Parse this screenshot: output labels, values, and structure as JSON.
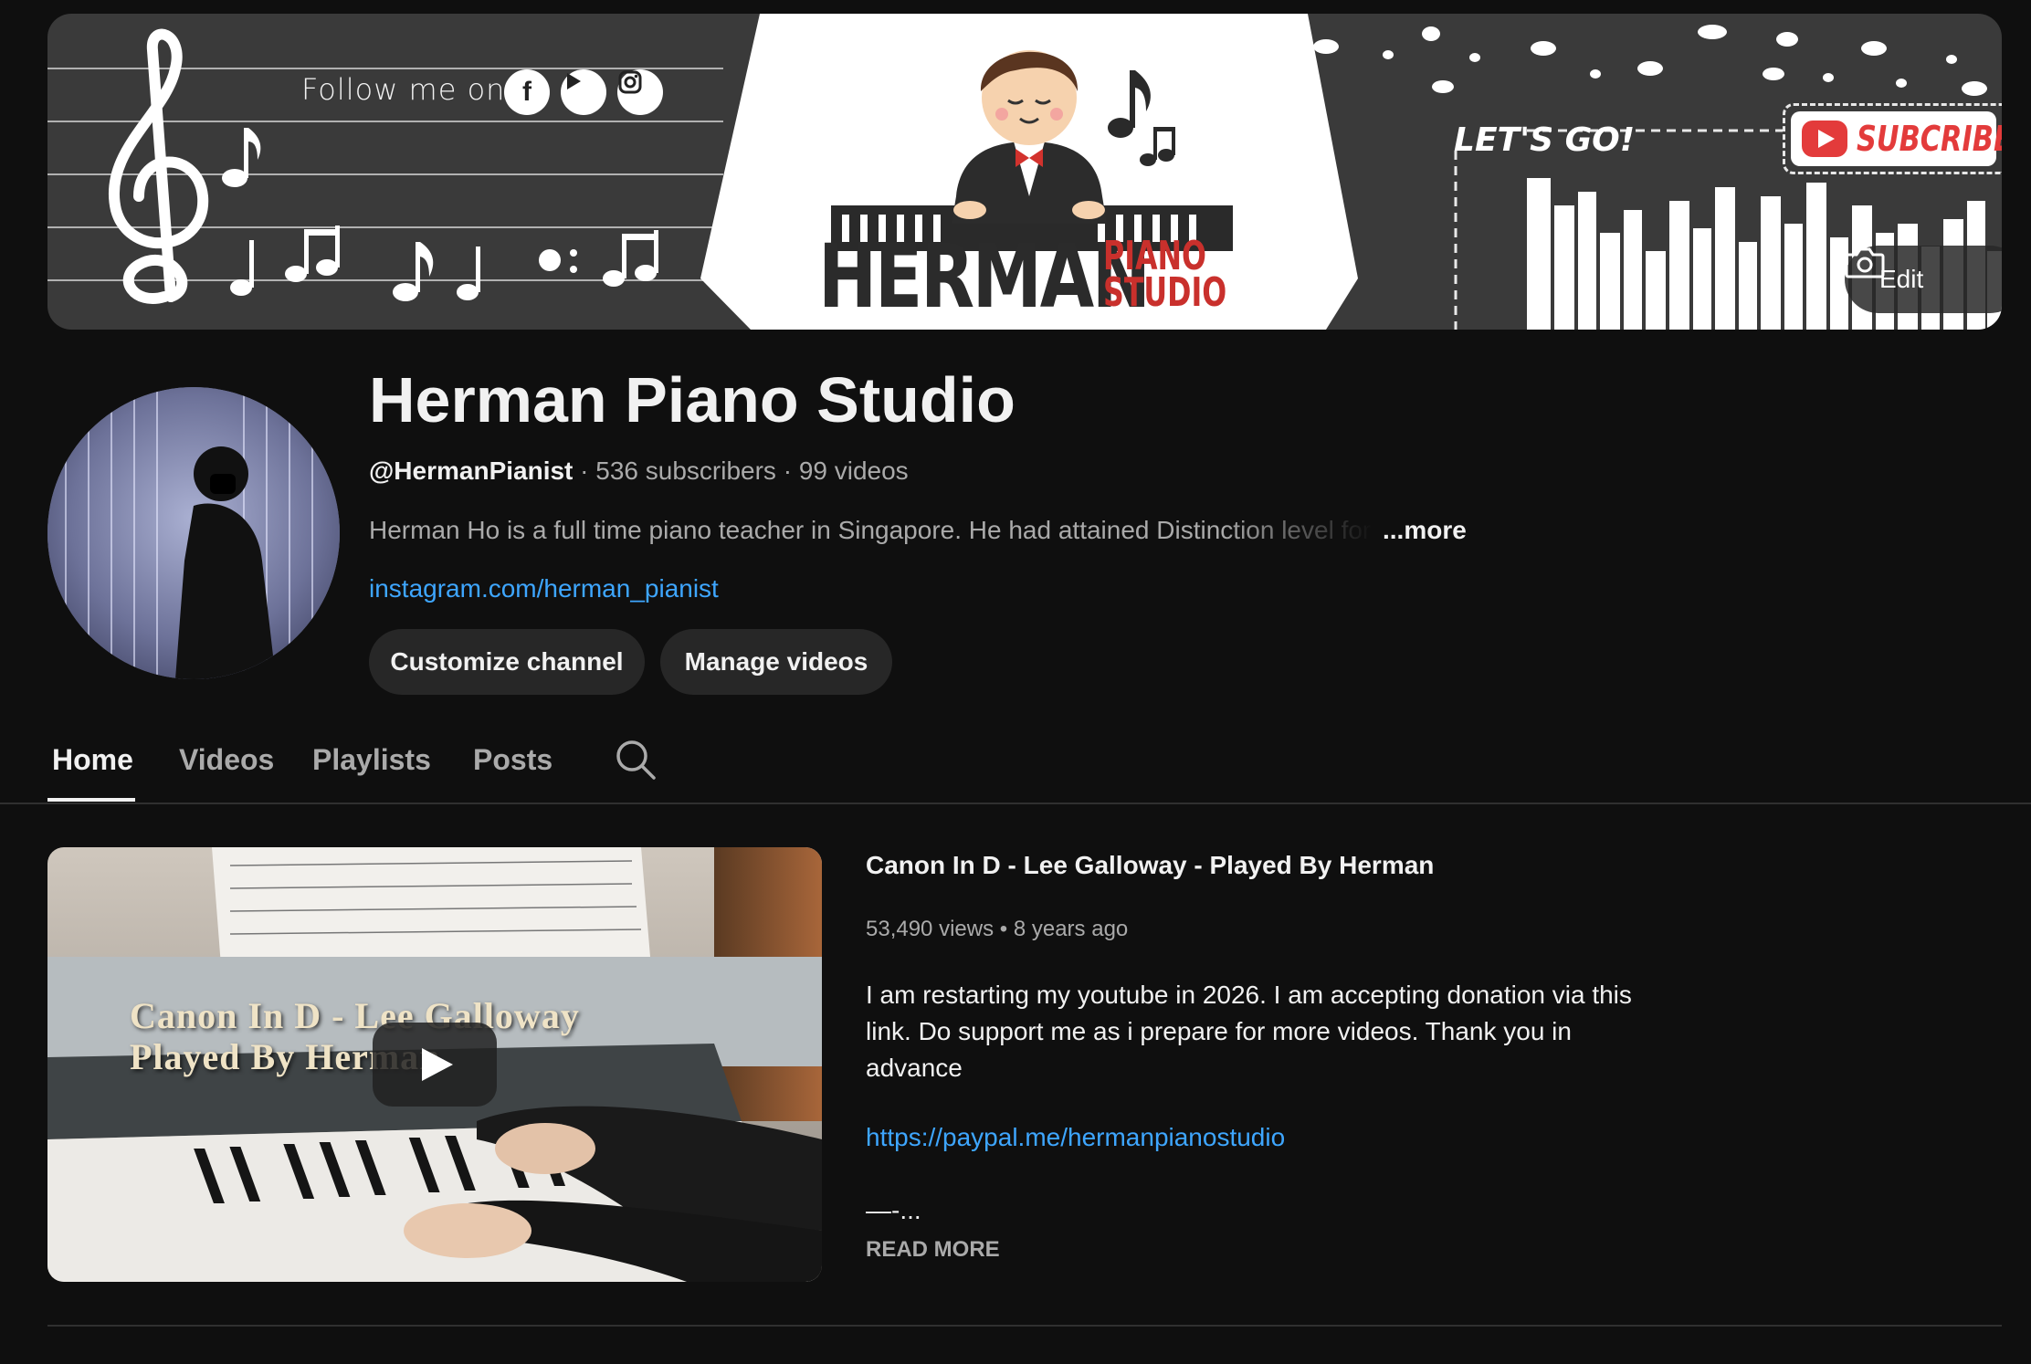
{
  "banner": {
    "follow_text": "Follow me on :",
    "social_icons": [
      "facebook-icon",
      "youtube-icon",
      "instagram-icon"
    ],
    "brand_main": "HERMAN",
    "brand_sub_line1": "PIANO",
    "brand_sub_line2": "STUDIO",
    "lets_go": "LET'S GO!",
    "subscribe": "SUBCRIBE!",
    "edit_label": "Edit"
  },
  "channel": {
    "title": "Herman Piano Studio",
    "handle": "@HermanPianist",
    "subscribers": "536 subscribers",
    "videos": "99 videos",
    "separator": " · ",
    "description": "Herman Ho is a full time piano teacher in Singapore. He had attained Distinction level for",
    "more": "...more",
    "link": "instagram.com/herman_pianist"
  },
  "actions": {
    "customize": "Customize channel",
    "manage": "Manage videos"
  },
  "tabs": [
    {
      "label": "Home",
      "active": true
    },
    {
      "label": "Videos",
      "active": false
    },
    {
      "label": "Playlists",
      "active": false
    },
    {
      "label": "Posts",
      "active": false
    }
  ],
  "featured": {
    "thumb_title_line1": "Canon In D - Lee Galloway",
    "thumb_title_line2": "Played By Herman",
    "title": "Canon In D - Lee Galloway - Played By Herman",
    "views": "53,490 views",
    "age": "8 years ago",
    "meta_separator": " • ",
    "description": "I am restarting my youtube in 2026. I am accepting donation via this link. Do support me as i prepare for more videos. Thank you in advance",
    "link": "https://paypal.me/hermanpianostudio",
    "dash": "—-...",
    "read_more": "READ MORE"
  },
  "colors": {
    "background": "#0f0f0f",
    "link": "#3ea6ff",
    "pill": "#272727",
    "brand_red": "#c9302c"
  }
}
